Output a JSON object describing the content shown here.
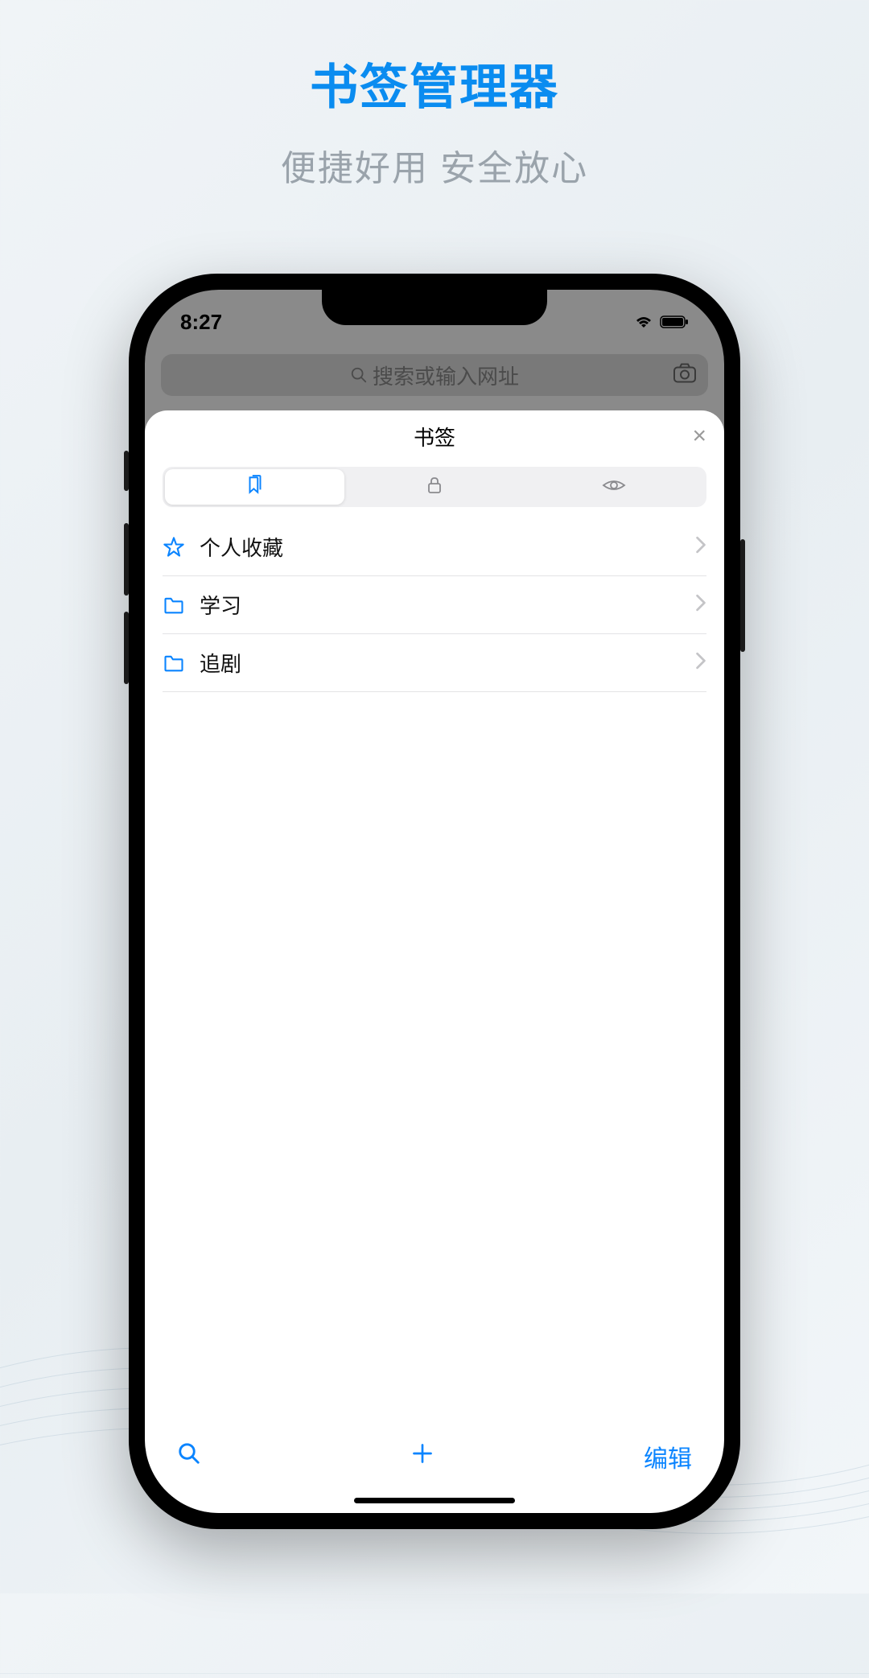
{
  "promo": {
    "title": "书签管理器",
    "subtitle": "便捷好用  安全放心"
  },
  "status": {
    "time": "8:27"
  },
  "search": {
    "placeholder": "搜索或输入网址"
  },
  "sheet": {
    "title": "书签",
    "close": "×",
    "tabs": {
      "bookmarks": "bookmarks-icon",
      "lock": "lock-icon",
      "eye": "eye-icon"
    }
  },
  "list": {
    "items": [
      {
        "icon": "star",
        "label": "个人收藏"
      },
      {
        "icon": "folder",
        "label": "学习"
      },
      {
        "icon": "folder",
        "label": "追剧"
      }
    ]
  },
  "bottom": {
    "edit": "编辑"
  },
  "colors": {
    "accent": "#0a84ff",
    "title": "#0a8cf0"
  }
}
